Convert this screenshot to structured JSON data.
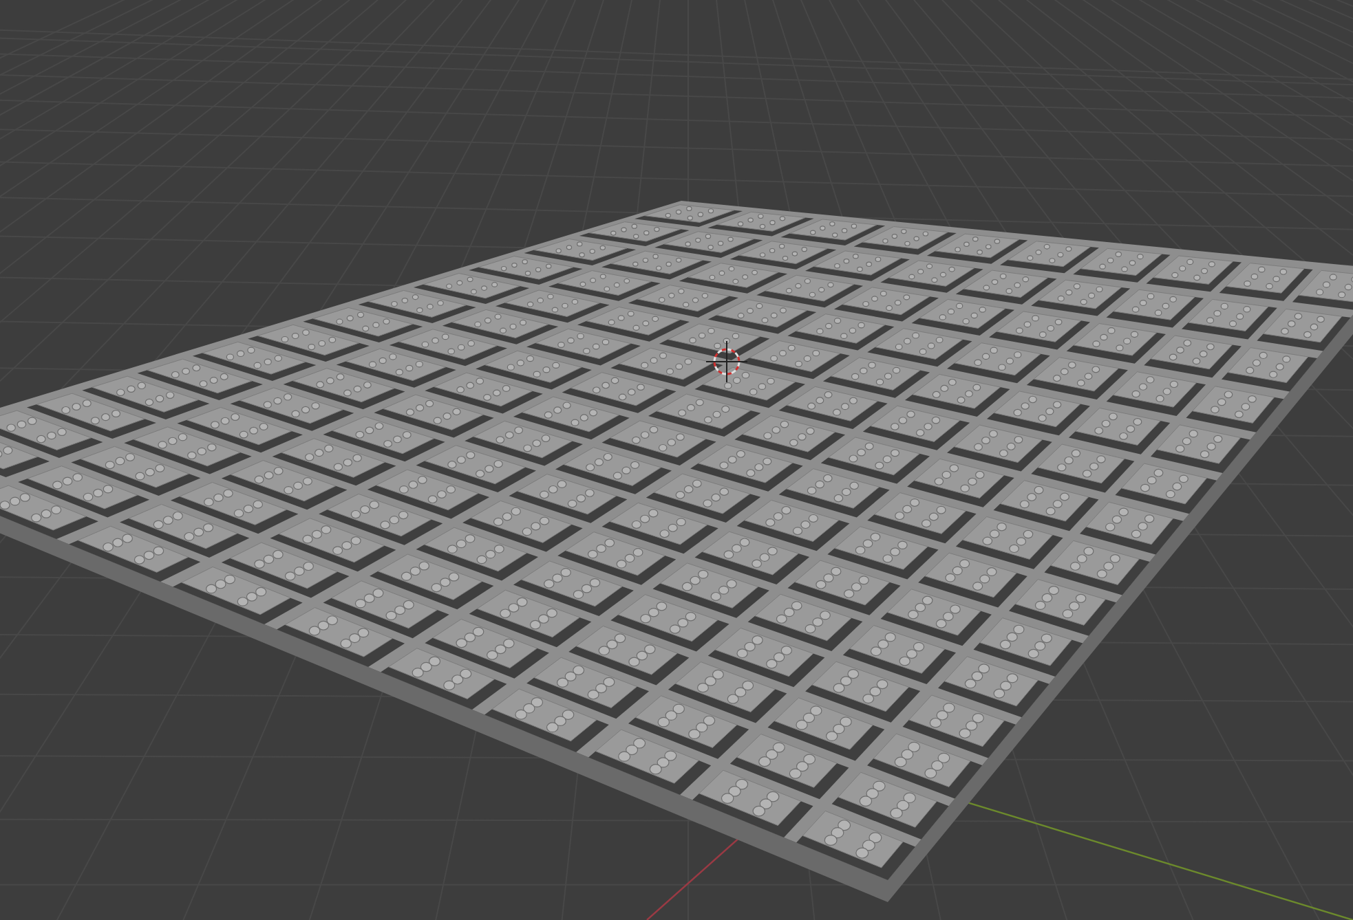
{
  "viewport": {
    "grid": true,
    "axes": true,
    "cursor": true,
    "plate": true
  }
}
